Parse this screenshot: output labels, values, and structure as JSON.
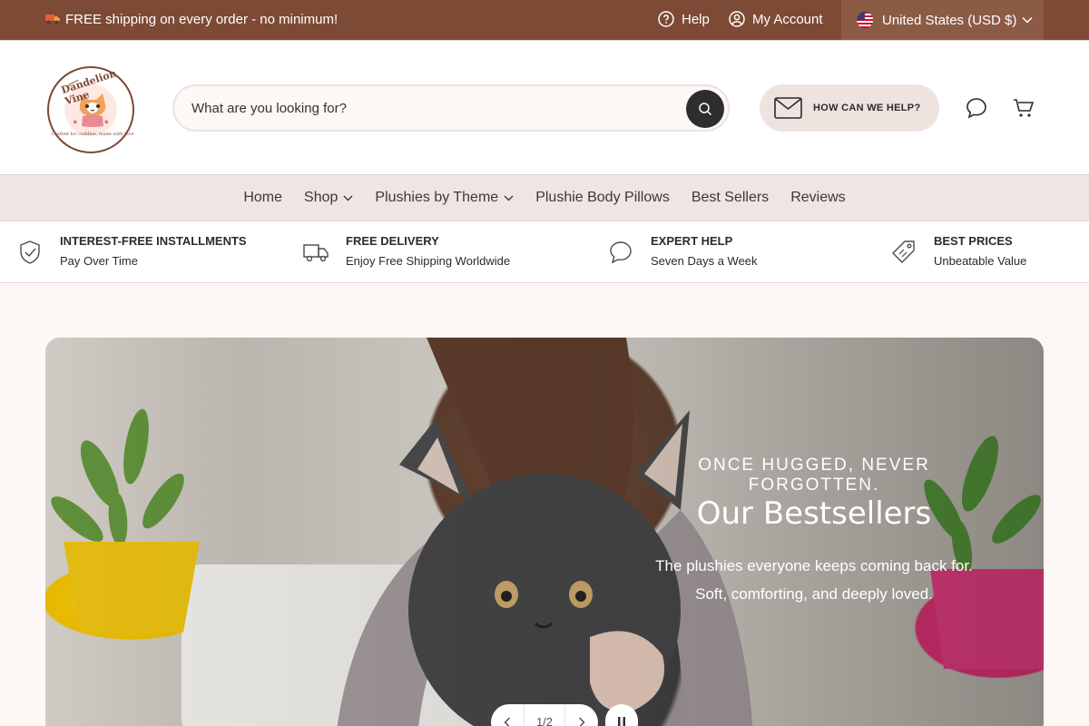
{
  "announcement": {
    "text": "FREE shipping on every order - no minimum!",
    "help_label": "Help",
    "account_label": "My Account",
    "region_label": "United States (USD $)"
  },
  "brand": {
    "name": "Dandelion Vine",
    "tagline": "Crafted for cuddles, made with love"
  },
  "search": {
    "placeholder": "What are you looking for?"
  },
  "header": {
    "help_button_label": "HOW CAN WE HELP?"
  },
  "nav": {
    "items": [
      {
        "label": "Home",
        "dropdown": false
      },
      {
        "label": "Shop",
        "dropdown": true
      },
      {
        "label": "Plushies by Theme",
        "dropdown": true
      },
      {
        "label": "Plushie Body Pillows",
        "dropdown": false
      },
      {
        "label": "Best Sellers",
        "dropdown": false
      },
      {
        "label": "Reviews",
        "dropdown": false
      }
    ]
  },
  "features": [
    {
      "icon": "shield-check-icon",
      "title": "INTEREST-FREE INSTALLMENTS",
      "subtitle": "Pay Over Time"
    },
    {
      "icon": "truck-icon",
      "title": "FREE DELIVERY",
      "subtitle": "Enjoy Free Shipping Worldwide"
    },
    {
      "icon": "chat-icon",
      "title": "EXPERT HELP",
      "subtitle": "Seven Days a Week"
    },
    {
      "icon": "tag-icon",
      "title": "BEST PRICES",
      "subtitle": "Unbeatable Value"
    }
  ],
  "hero": {
    "eyebrow": "ONCE HUGGED, NEVER FORGOTTEN.",
    "title": "Our Bestsellers",
    "subtitle_line1": "The plushies everyone keeps coming back for.",
    "subtitle_line2": "Soft, comforting, and deeply loved.",
    "slide_counter": "1/2"
  },
  "colors": {
    "topbar": "#7d4a35",
    "region_bg": "#8c5b46",
    "nav_bg": "#efe5e2",
    "help_pill_bg": "#efe3df"
  }
}
